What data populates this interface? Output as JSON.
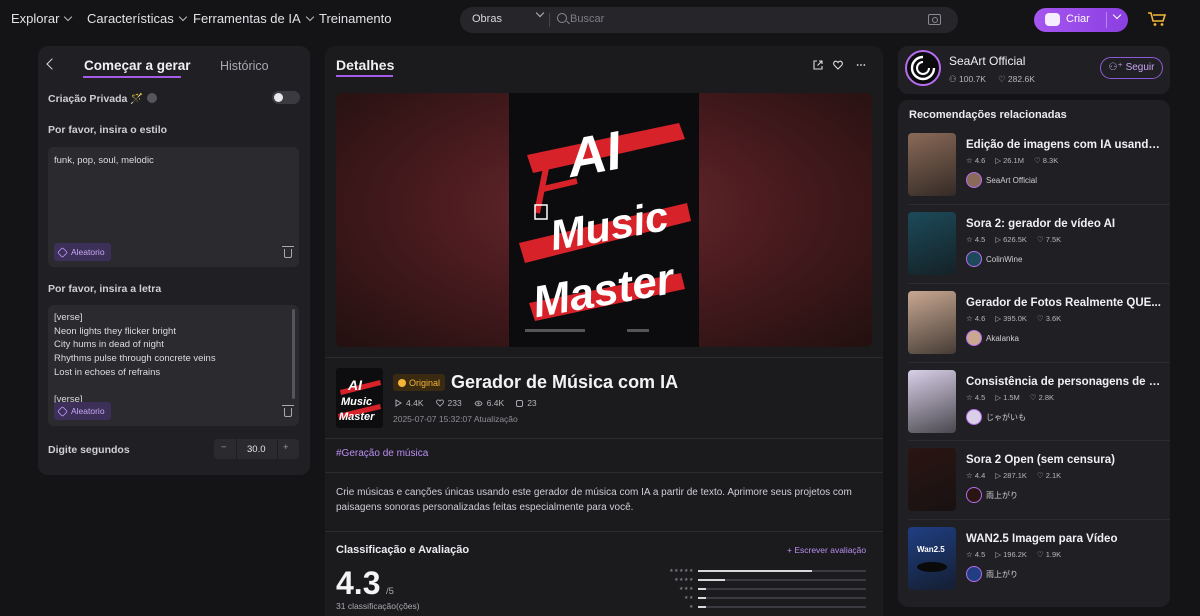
{
  "nav": {
    "explorar": "Explorar",
    "caracteristicas": "Características",
    "ferramentas": "Ferramentas de IA",
    "treinamento": "Treinamento",
    "search_category": "Obras",
    "search_placeholder": "Buscar",
    "create_label": "Criar"
  },
  "left": {
    "tab_active": "Começar a gerar",
    "tab_other": "Histórico",
    "private_label": "Criação Privada 🪄",
    "style_label": "Por favor, insira o estilo",
    "style_value": "funk, pop, soul, melodic",
    "random_label": "Aleatorio",
    "lyrics_label": "Por favor, insira a letra",
    "lyrics_value": "[verse]\nNeon lights they flicker bright\nCity hums in dead of night\nRhythms pulse through concrete veins\nLost in echoes of refrains\n\n[verse]",
    "seconds_label": "Digite segundos",
    "seconds_value": "30.0",
    "minus": "−",
    "plus": "+"
  },
  "main": {
    "header": "Detalhes",
    "poster_text": [
      "AI",
      "Music",
      "Master"
    ],
    "badge": "Original",
    "title": "Gerador de Música com IA",
    "stats": {
      "runs": "4.4K",
      "likes": "233",
      "views": "6.4K",
      "shares": "23"
    },
    "date": "2025-07-07 15:32:07 Atualização",
    "hashtag": "#Geração de música",
    "description": "Crie músicas e canções únicas usando este gerador de música com IA a partir de texto. Aprimore seus projetos com paisagens sonoras personalizadas feitas especialmente para você.",
    "rating_header": "Classificação e Avaliação",
    "write_review": "+ Escrever avaliação",
    "score": "4.3",
    "score_of": "/5",
    "rating_count": "31 classificação(ções)",
    "rating_bars": [
      {
        "stars": "★★★★★",
        "fraction": 0.68
      },
      {
        "stars": "★★★★",
        "fraction": 0.16
      },
      {
        "stars": "★★★",
        "fraction": 0.05
      },
      {
        "stars": "★★",
        "fraction": 0.05
      },
      {
        "stars": "★",
        "fraction": 0.05
      }
    ]
  },
  "profile": {
    "name": "SeaArt Official",
    "followers": "100.7K",
    "likes": "282.6K",
    "follow_label": "Seguir"
  },
  "recs": {
    "header": "Recomendações relacionadas",
    "items": [
      {
        "title": "Edição de imagens com IA usando ...",
        "rating": "4.6",
        "runs": "26.1M",
        "likes": "8.3K",
        "author": "SeaArt Official",
        "color": "#8a6a58"
      },
      {
        "title": "Sora 2: gerador de vídeo AI",
        "rating": "4.5",
        "runs": "626.5K",
        "likes": "7.5K",
        "author": "ColinWine",
        "color": "#1c4a5a"
      },
      {
        "title": "Gerador de Fotos Realmente QUE...",
        "rating": "4.6",
        "runs": "395.0K",
        "likes": "3.6K",
        "author": "Akalanka",
        "color": "#c9a892"
      },
      {
        "title": "Consistência de personagens de a...",
        "rating": "4.5",
        "runs": "1.5M",
        "likes": "2.8K",
        "author": "じゃがいも",
        "color": "#d9d0e8"
      },
      {
        "title": "Sora 2 Open (sem censura)",
        "rating": "4.4",
        "runs": "287.1K",
        "likes": "2.1K",
        "author": "雨上がり",
        "color": "#2a1512"
      },
      {
        "title": "WAN2.5 Imagem para Vídeo",
        "rating": "4.5",
        "runs": "196.2K",
        "likes": "1.9K",
        "author": "雨上がり",
        "color": "#1f3f82",
        "thumb_text": "Wan2.5"
      }
    ]
  },
  "colors": {
    "accent": "#a35be8",
    "gold": "#f4b537",
    "bg": "#141416",
    "panel": "#202024"
  }
}
